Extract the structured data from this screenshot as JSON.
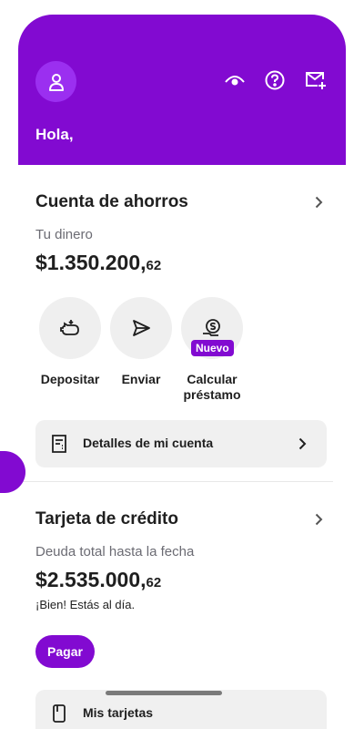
{
  "header": {
    "greeting": "Hola,",
    "icons": [
      "user-icon",
      "eye-icon",
      "help-icon",
      "mail-plus-icon"
    ],
    "color": "#820ad1"
  },
  "savings": {
    "title": "Cuenta de ahorros",
    "subtitle": "Tu dinero",
    "amount_main": "$1.350.200,",
    "amount_cents": "62",
    "actions": [
      {
        "label": "Depositar",
        "icon": "piggy-bank-icon"
      },
      {
        "label": "Enviar",
        "icon": "send-icon"
      },
      {
        "label": "Calcular préstamo",
        "icon": "loan-icon",
        "badge": "Nuevo"
      }
    ],
    "details_label": "Detalles de mi cuenta"
  },
  "credit": {
    "title": "Tarjeta de crédito",
    "subtitle": "Deuda total hasta la fecha",
    "amount_main": "$2.535.000,",
    "amount_cents": "62",
    "status": "¡Bien! Estás al día.",
    "pay_label": "Pagar",
    "cards_label": "Mis tarjetas"
  }
}
